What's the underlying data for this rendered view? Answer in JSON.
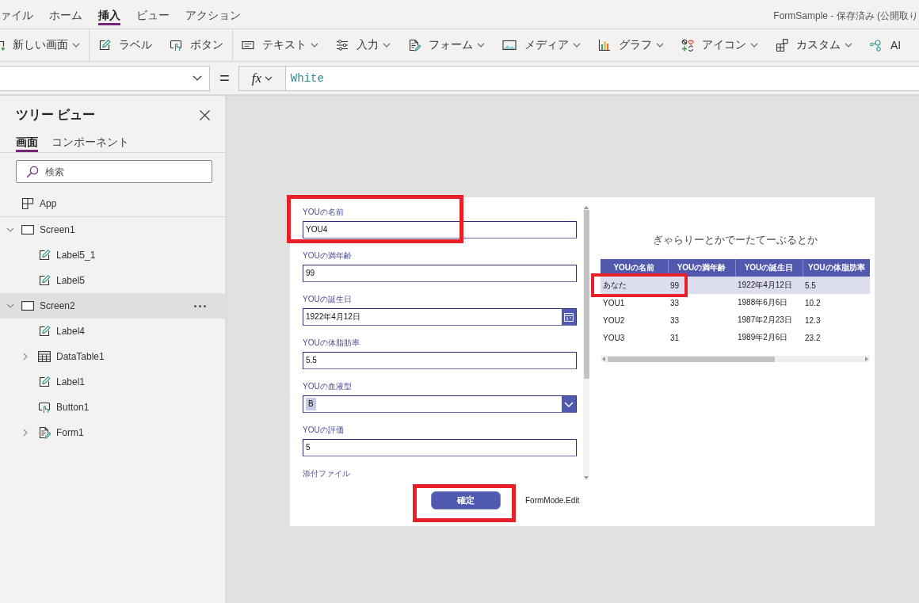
{
  "menu_bar": {
    "items": [
      {
        "label": "ァイル",
        "selected": false
      },
      {
        "label": "ホーム",
        "selected": false
      },
      {
        "label": "挿入",
        "selected": true
      },
      {
        "label": "ビュー",
        "selected": false
      },
      {
        "label": "アクション",
        "selected": false
      }
    ],
    "document_title": "FormSample - 保存済み (公開取り"
  },
  "toolbar": {
    "groups": [
      {
        "items": [
          {
            "label": "新しい画面",
            "dropdown": true
          }
        ]
      },
      {
        "items": [
          {
            "label": "ラベル",
            "dropdown": false
          },
          {
            "label": "ボタン",
            "dropdown": false
          }
        ]
      },
      {
        "items": [
          {
            "label": "テキスト",
            "dropdown": true
          },
          {
            "label": "入力",
            "dropdown": true
          },
          {
            "label": "フォーム",
            "dropdown": true
          },
          {
            "label": "メディア",
            "dropdown": true
          },
          {
            "label": "グラフ",
            "dropdown": true
          },
          {
            "label": "アイコン",
            "dropdown": true
          },
          {
            "label": "カスタム",
            "dropdown": true
          },
          {
            "label": "AI",
            "dropdown": false
          }
        ]
      }
    ]
  },
  "formula_bar": {
    "equals": "=",
    "function_label": "fx",
    "formula": "White"
  },
  "tree_view": {
    "title": "ツリー ビュー",
    "tabs": [
      {
        "label": "画面",
        "selected": true
      },
      {
        "label": "コンポーネント",
        "selected": false
      }
    ],
    "search": {
      "placeholder": "検索"
    },
    "items": [
      {
        "label": "App",
        "kind": "app",
        "selected": false
      },
      {
        "label": "Screen1",
        "kind": "screen",
        "expanded": true,
        "selected": false,
        "children": [
          {
            "label": "Label5_1",
            "kind": "label",
            "selected": false
          },
          {
            "label": "Label5",
            "kind": "label",
            "selected": false
          }
        ]
      },
      {
        "label": "Screen2",
        "kind": "screen",
        "expanded": true,
        "selected": true,
        "children": [
          {
            "label": "Label4",
            "kind": "label",
            "selected": false
          },
          {
            "label": "DataTable1",
            "kind": "table",
            "expanded": false,
            "selected": false
          },
          {
            "label": "Label1",
            "kind": "label",
            "selected": false
          },
          {
            "label": "Button1",
            "kind": "button",
            "selected": false
          },
          {
            "label": "Form1",
            "kind": "form",
            "expanded": false,
            "selected": false
          }
        ]
      }
    ]
  },
  "form": {
    "fields": [
      {
        "label": "YOUの名前",
        "kind": "text",
        "value": "YOU4",
        "highlighted": true
      },
      {
        "label": "YOUの満年齢",
        "kind": "text",
        "value": "99",
        "highlighted": false
      },
      {
        "label": "YOUの誕生日",
        "kind": "date",
        "value": "1922年4月12日",
        "highlighted": false
      },
      {
        "label": "YOUの体脂肪率",
        "kind": "text",
        "value": "5.5",
        "highlighted": false
      },
      {
        "label": "YOUの血液型",
        "kind": "dropdown",
        "value": "B",
        "highlighted": false
      },
      {
        "label": "YOUの評価",
        "kind": "text",
        "value": "5",
        "highlighted": false
      },
      {
        "label": "添付ファイル",
        "kind": "attachment",
        "highlighted": false
      }
    ],
    "submit_button": {
      "label": "確定",
      "highlighted": true
    },
    "mode_label": "FormMode.Edit"
  },
  "gallery": {
    "title": "ぎゃらりーとかでーたてーぶるとか",
    "table": {
      "columns": [
        "YOUの名前",
        "YOUの満年齢",
        "YOUの誕生日",
        "YOUの体脂肪率"
      ],
      "rows": [
        {
          "cells": [
            "あなた",
            "99",
            "1922年4月12日",
            "5.5"
          ],
          "selected": true,
          "highlighted": true
        },
        {
          "cells": [
            "YOU1",
            "33",
            "1988年6月6日",
            "10.2"
          ],
          "selected": false,
          "highlighted": false
        },
        {
          "cells": [
            "YOU2",
            "33",
            "1987年2月23日",
            "12.3"
          ],
          "selected": false,
          "highlighted": false
        },
        {
          "cells": [
            "YOU3",
            "31",
            "1989年2月6日",
            "23.2"
          ],
          "selected": false,
          "highlighted": false
        }
      ]
    }
  }
}
